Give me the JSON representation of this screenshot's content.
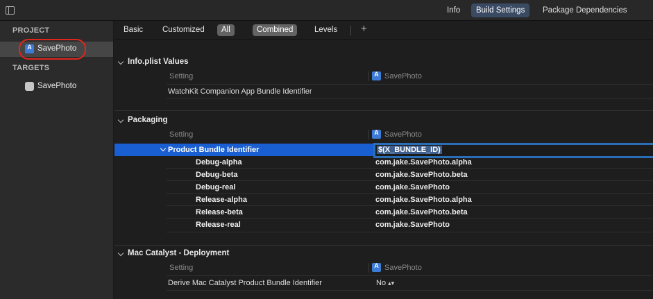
{
  "topbar": {
    "tabs": [
      {
        "label": "Info",
        "active": false
      },
      {
        "label": "Build Settings",
        "active": true
      },
      {
        "label": "Package Dependencies",
        "active": false
      }
    ]
  },
  "sidebar": {
    "project_header": "PROJECT",
    "project_item": "SavePhoto",
    "targets_header": "TARGETS",
    "target_item": "SavePhoto"
  },
  "filters": {
    "basic": "Basic",
    "customized": "Customized",
    "all": "All",
    "combined": "Combined",
    "levels": "Levels",
    "add": "+"
  },
  "sections": {
    "info_plist": {
      "title": "Info.plist Values",
      "col_setting": "Setting",
      "col_target": "SavePhoto",
      "rows": [
        "WatchKit Companion App Bundle Identifier"
      ]
    },
    "packaging": {
      "title": "Packaging",
      "col_setting": "Setting",
      "col_target": "SavePhoto",
      "selected_setting": "Product Bundle Identifier",
      "selected_value": "$(X_BUNDLE_ID)",
      "configs": [
        {
          "name": "Debug-alpha",
          "value": "com.jake.SavePhoto.alpha"
        },
        {
          "name": "Debug-beta",
          "value": "com.jake.SavePhoto.beta"
        },
        {
          "name": "Debug-real",
          "value": "com.jake.SavePhoto"
        },
        {
          "name": "Release-alpha",
          "value": "com.jake.SavePhoto.alpha"
        },
        {
          "name": "Release-beta",
          "value": "com.jake.SavePhoto.beta"
        },
        {
          "name": "Release-real",
          "value": "com.jake.SavePhoto"
        }
      ]
    },
    "catalyst": {
      "title": "Mac Catalyst - Deployment",
      "col_setting": "Setting",
      "col_target": "SavePhoto",
      "row_setting": "Derive Mac Catalyst Product Bundle Identifier",
      "row_value": "No",
      "row_value_icon": "updown-arrows-icon"
    }
  },
  "colors": {
    "selection": "#1a5fd1",
    "highlight_ring": "#e0261b",
    "project_icon": "#3c7bd6"
  }
}
